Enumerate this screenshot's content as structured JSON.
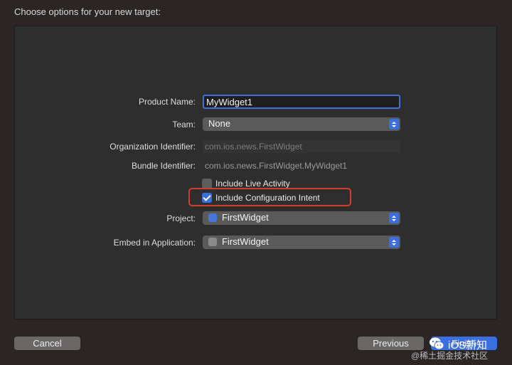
{
  "dialog": {
    "title": "Choose options for your new target:"
  },
  "form": {
    "product_name_label": "Product Name:",
    "product_name_value": "MyWidget1",
    "team_label": "Team:",
    "team_value": "None",
    "org_label": "Organization Identifier:",
    "org_placeholder": "com.ios.news.FirstWidget",
    "bundle_label": "Bundle Identifier:",
    "bundle_value": "com.ios.news.FirstWidget.MyWidget1",
    "live_activity_label": "Include Live Activity",
    "live_activity_checked": false,
    "config_intent_label": "Include Configuration Intent",
    "config_intent_checked": true,
    "project_label": "Project:",
    "project_value": "FirstWidget",
    "embed_label": "Embed in Application:",
    "embed_value": "FirstWidget"
  },
  "footer": {
    "cancel_label": "Cancel",
    "previous_label": "Previous",
    "finish_label": "Finish"
  },
  "watermark": {
    "brand": "iOS新知",
    "sub": "@稀土掘金技术社区"
  },
  "colors": {
    "accent": "#3b6fe0",
    "highlight": "#d23c2c",
    "background": "#2b2525"
  }
}
